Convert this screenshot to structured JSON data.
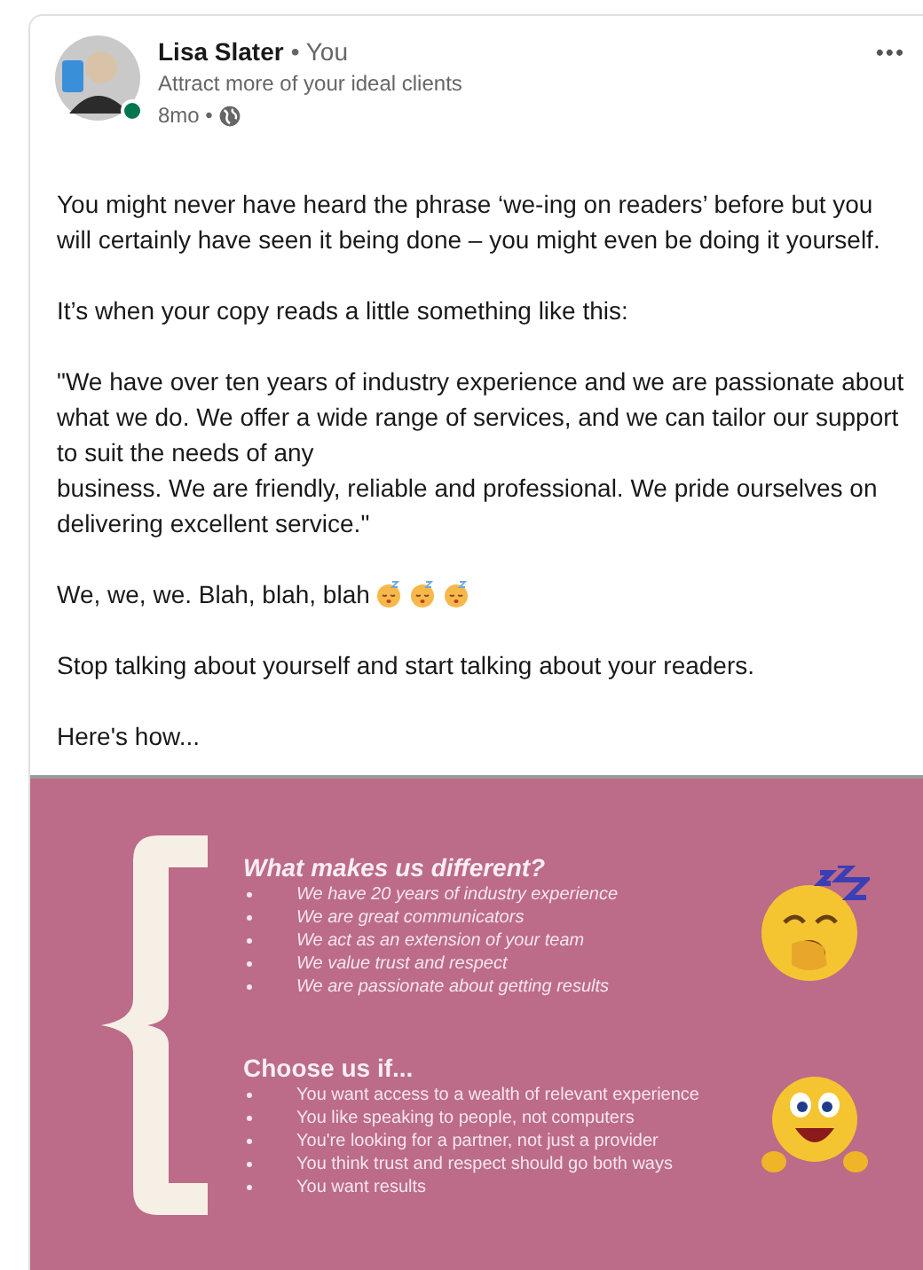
{
  "post": {
    "author": {
      "name": "Lisa Slater",
      "relation": "• You",
      "headline": "Attract more of your ideal clients",
      "time": "8mo •",
      "online": true
    },
    "more_menu": "•••",
    "paragraphs": [
      {
        "text": "You might never have heard the phrase ‘we-ing on readers’ before but you will certainly have seen it being done – you might even be doing it yourself."
      },
      {
        "text": "It’s when your copy reads a little something like this:"
      },
      {
        "text": "\"We have over ten years of industry experience and we are passionate about what we do. We offer a wide range of services, and we can tailor our support to suit the needs of any\nbusiness. We are friendly, reliable and professional. We pride ourselves on delivering excellent service.\""
      },
      {
        "text": "We, we, we. Blah, blah, blah",
        "kind": "sleepy"
      },
      {
        "text": "Stop talking about yourself and start talking about your readers."
      },
      {
        "text": "Here's how..."
      }
    ],
    "slide": {
      "sections": [
        {
          "heading": "What makes us different?",
          "italic": true,
          "kind": "yawning",
          "items": [
            "We have 20 years of industry experience",
            "We are great communicators",
            "We act as an extension of your team",
            "We value trust and respect",
            "We are passionate about getting results"
          ]
        },
        {
          "heading": "Choose us if...",
          "italic": false,
          "kind": "excited",
          "items": [
            "You want access to a wealth of relevant experience",
            "You like speaking to people, not computers",
            "You're looking for a partner, not just a provider",
            "You think trust and respect should go both ways",
            "You want results"
          ]
        }
      ]
    }
  }
}
